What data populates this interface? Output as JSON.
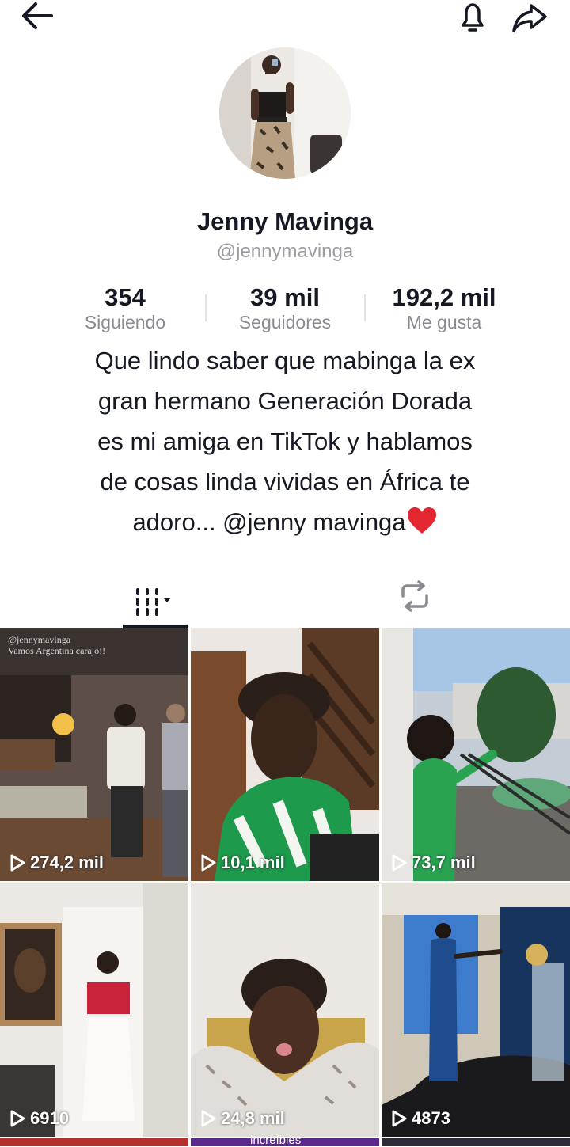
{
  "header": {
    "back_icon": "arrow-left-icon",
    "bell_icon": "bell-icon",
    "share_icon": "share-arrow-icon"
  },
  "profile": {
    "name": "Jenny Mavinga",
    "handle": "@jennymavinga",
    "stats": [
      {
        "value": "354",
        "label": "Siguiendo"
      },
      {
        "value": "39 mil",
        "label": "Seguidores"
      },
      {
        "value": "192,2 mil",
        "label": "Me gusta"
      }
    ]
  },
  "bio": {
    "lines": [
      "Que lindo saber que mabinga la ex",
      "gran hermano Generación Dorada",
      "es mi amiga en TikTok y hablamos",
      "de cosas linda vividas en África te",
      "adoro... @jenny mavinga"
    ],
    "emoji": "red-heart"
  },
  "tabs": {
    "videos_icon": "grid-videos-icon",
    "reposts_icon": "repost-icon"
  },
  "videos": [
    {
      "views": "274,2 mil",
      "caption_line1": "@jennymavinga",
      "caption_line2": "Vamos Argentina carajo!!"
    },
    {
      "views": "10,1 mil"
    },
    {
      "views": "73,7 mil"
    },
    {
      "views": "6910"
    },
    {
      "views": "24,8 mil"
    },
    {
      "views": "4873"
    }
  ],
  "partial_row_text": "increíbles"
}
